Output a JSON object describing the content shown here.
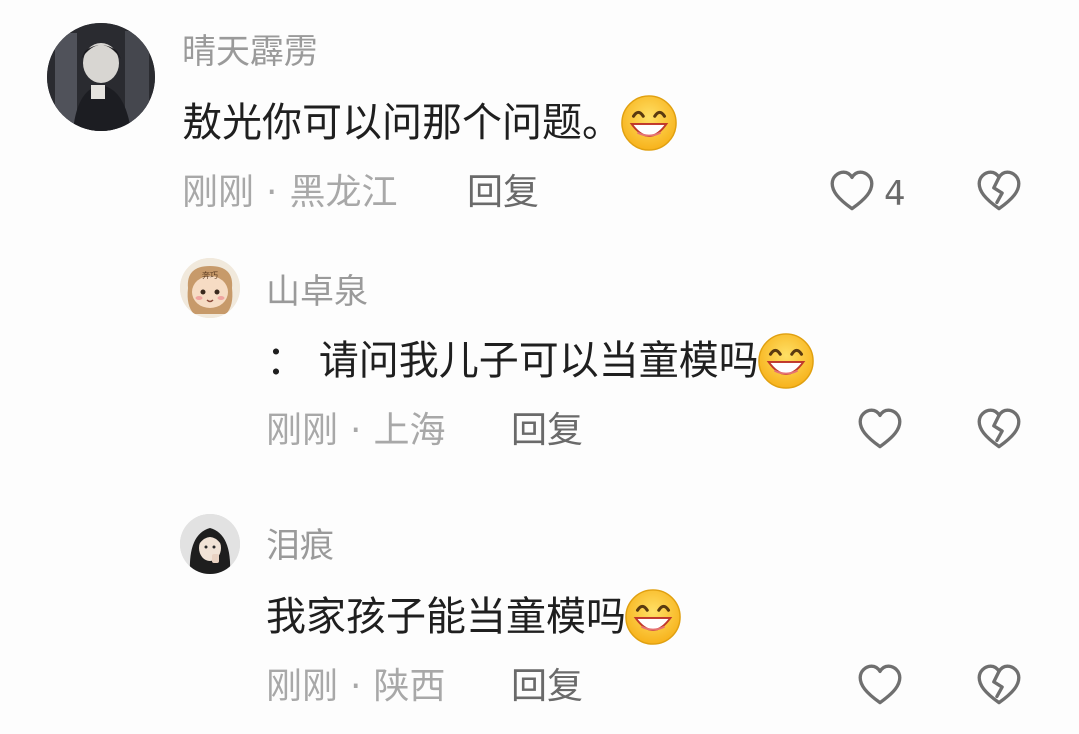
{
  "comments": [
    {
      "username": "晴天霹雳",
      "text": "敖光你可以问那个问题。",
      "emoji": "grinning-face-emoji",
      "time": "刚刚",
      "separator": "·",
      "location": "黑龙江",
      "reply_label": "回复",
      "like_count": "4"
    },
    {
      "username": "山卓泉",
      "avatar_text": "奔巧",
      "text": "： 请问我儿子可以当童模吗",
      "emoji": "grinning-face-emoji",
      "time": "刚刚",
      "separator": "·",
      "location": "上海",
      "reply_label": "回复"
    },
    {
      "username": "泪痕",
      "text": "我家孩子能当童模吗",
      "emoji": "grinning-face-emoji",
      "time": "刚刚",
      "separator": "·",
      "location": "陕西",
      "reply_label": "回复"
    }
  ],
  "icons": {
    "like": "heart-outline-icon",
    "dislike": "broken-heart-icon"
  },
  "colors": {
    "text": "#1f1f1f",
    "username": "#9a9a9a",
    "meta": "#a8a8a8",
    "icon": "#6f6f6f",
    "emoji_face": "#ffcc33"
  }
}
